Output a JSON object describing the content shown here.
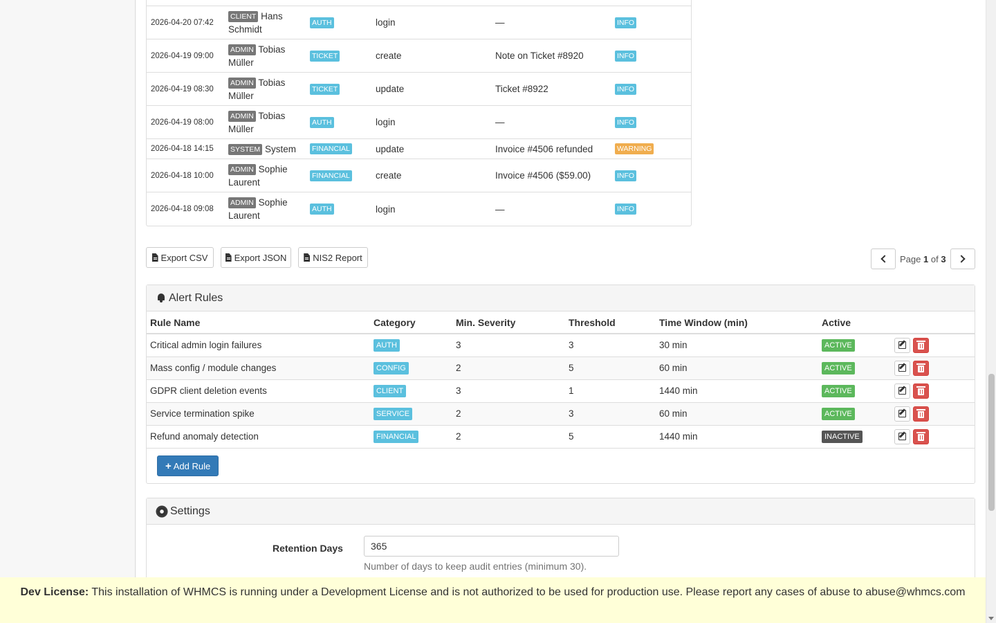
{
  "log": {
    "rows": [
      {
        "date": "2026-04-20 07:42",
        "role": "CLIENT",
        "user": "Hans Schmidt",
        "category": "AUTH",
        "action": "login",
        "target": "—",
        "level": "INFO"
      },
      {
        "date": "2026-04-19 09:00",
        "role": "ADMIN",
        "user": "Tobias Müller",
        "category": "TICKET",
        "action": "create",
        "target": "Note on Ticket #8920",
        "level": "INFO"
      },
      {
        "date": "2026-04-19 08:30",
        "role": "ADMIN",
        "user": "Tobias Müller",
        "category": "TICKET",
        "action": "update",
        "target": "Ticket #8922",
        "level": "INFO"
      },
      {
        "date": "2026-04-19 08:00",
        "role": "ADMIN",
        "user": "Tobias Müller",
        "category": "AUTH",
        "action": "login",
        "target": "—",
        "level": "INFO"
      },
      {
        "date": "2026-04-18 14:15",
        "role": "SYSTEM",
        "user": "System",
        "category": "FINANCIAL",
        "action": "update",
        "target": "Invoice #4506 refunded",
        "level": "WARNING"
      },
      {
        "date": "2026-04-18 10:00",
        "role": "ADMIN",
        "user": "Sophie Laurent",
        "category": "FINANCIAL",
        "action": "create",
        "target": "Invoice #4506 ($59.00)",
        "level": "INFO"
      },
      {
        "date": "2026-04-18 09:08",
        "role": "ADMIN",
        "user": "Sophie Laurent",
        "category": "AUTH",
        "action": "login",
        "target": "—",
        "level": "INFO"
      }
    ]
  },
  "export": {
    "csv_label": "Export CSV",
    "json_label": "Export JSON",
    "nis2_label": "NIS2 Report"
  },
  "pager": {
    "page_word": "Page",
    "current": "1",
    "of_word": "of",
    "total": "3"
  },
  "alert_rules": {
    "title": "Alert Rules",
    "headers": [
      "Rule Name",
      "Category",
      "Min. Severity",
      "Threshold",
      "Time Window (min)",
      "Active"
    ],
    "rows": [
      {
        "name": "Critical admin login failures",
        "category": "AUTH",
        "severity": "3",
        "threshold": "3",
        "window": "30 min",
        "status": "ACTIVE"
      },
      {
        "name": "Mass config / module changes",
        "category": "CONFIG",
        "severity": "2",
        "threshold": "5",
        "window": "60 min",
        "status": "ACTIVE"
      },
      {
        "name": "GDPR client deletion events",
        "category": "CLIENT",
        "severity": "3",
        "threshold": "1",
        "window": "1440 min",
        "status": "ACTIVE"
      },
      {
        "name": "Service termination spike",
        "category": "SERVICE",
        "severity": "2",
        "threshold": "3",
        "window": "60 min",
        "status": "ACTIVE"
      },
      {
        "name": "Refund anomaly detection",
        "category": "FINANCIAL",
        "severity": "2",
        "threshold": "5",
        "window": "1440 min",
        "status": "INACTIVE"
      }
    ],
    "add_label": "Add Rule"
  },
  "settings": {
    "title": "Settings",
    "retention_label": "Retention Days",
    "retention_value": "365",
    "retention_help": "Number of days to keep audit entries (minimum 30)."
  },
  "banner": {
    "strong": "Dev License:",
    "text": " This installation of WHMCS is running under a Development License and is not authorized to be used for production use. Please report any cases of abuse to abuse@whmcs.com"
  },
  "colors": {
    "info": "#5bc0de",
    "warning": "#f0ad4e",
    "success": "#5cb85c",
    "primary": "#337ab7",
    "danger": "#d9534f"
  }
}
